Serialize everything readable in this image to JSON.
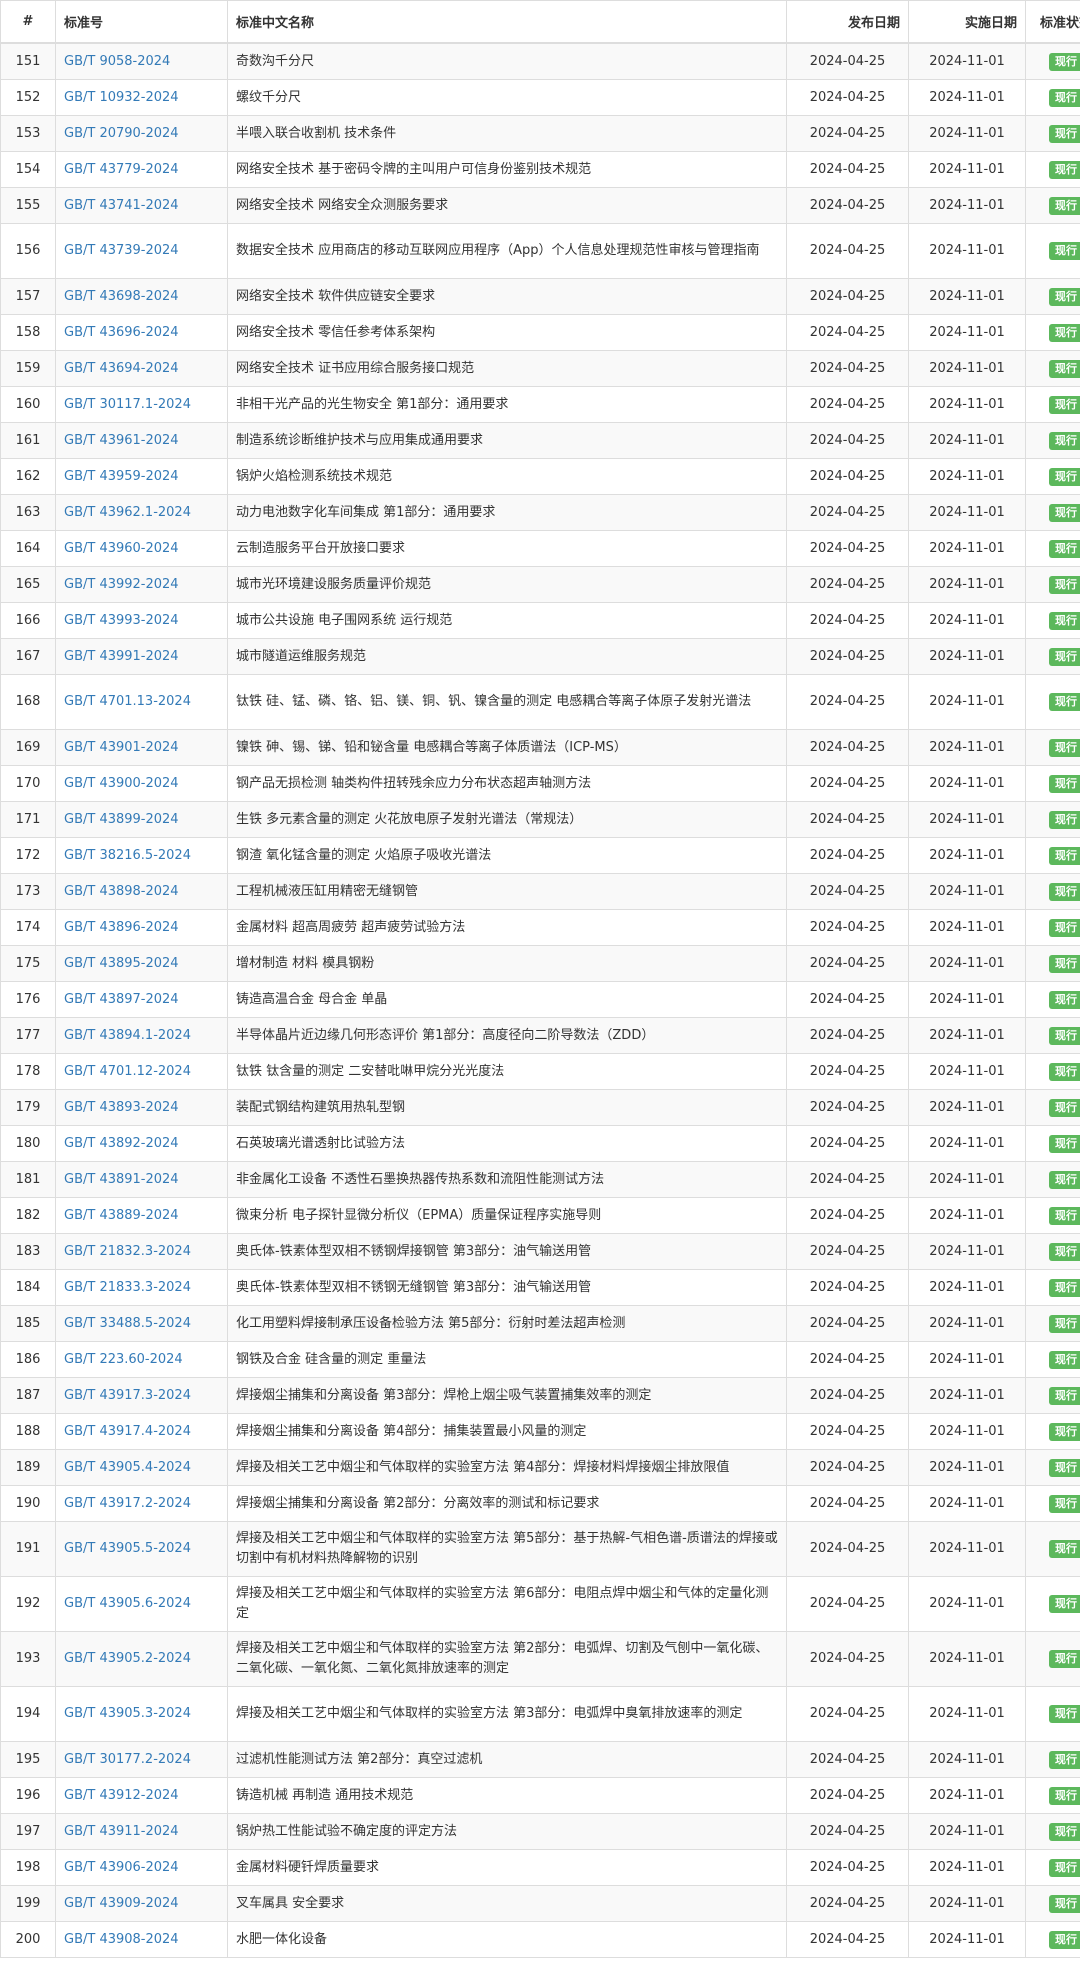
{
  "table": {
    "headers": {
      "num": "#",
      "code": "标准号",
      "name": "标准中文名称",
      "pub_date": "发布日期",
      "impl_date": "实施日期",
      "status": "标准状态"
    },
    "rows": [
      {
        "num": "151",
        "code": "GB/T 9058-2024",
        "name": "奇数沟千分尺",
        "pub": "2024-04-25",
        "impl": "2024-11-01",
        "status": "现行"
      },
      {
        "num": "152",
        "code": "GB/T 10932-2024",
        "name": "螺纹千分尺",
        "pub": "2024-04-25",
        "impl": "2024-11-01",
        "status": "现行"
      },
      {
        "num": "153",
        "code": "GB/T 20790-2024",
        "name": "半喂入联合收割机 技术条件",
        "pub": "2024-04-25",
        "impl": "2024-11-01",
        "status": "现行"
      },
      {
        "num": "154",
        "code": "GB/T 43779-2024",
        "name": "网络安全技术 基于密码令牌的主叫用户可信身份鉴别技术规范",
        "pub": "2024-04-25",
        "impl": "2024-11-01",
        "status": "现行"
      },
      {
        "num": "155",
        "code": "GB/T 43741-2024",
        "name": "网络安全技术 网络安全众测服务要求",
        "pub": "2024-04-25",
        "impl": "2024-11-01",
        "status": "现行"
      },
      {
        "num": "156",
        "code": "GB/T 43739-2024",
        "name": "数据安全技术 应用商店的移动互联网应用程序（App）个人信息处理规范性审核与管理指南",
        "pub": "2024-04-25",
        "impl": "2024-11-01",
        "status": "现行"
      },
      {
        "num": "157",
        "code": "GB/T 43698-2024",
        "name": "网络安全技术 软件供应链安全要求",
        "pub": "2024-04-25",
        "impl": "2024-11-01",
        "status": "现行"
      },
      {
        "num": "158",
        "code": "GB/T 43696-2024",
        "name": "网络安全技术 零信任参考体系架构",
        "pub": "2024-04-25",
        "impl": "2024-11-01",
        "status": "现行"
      },
      {
        "num": "159",
        "code": "GB/T 43694-2024",
        "name": "网络安全技术 证书应用综合服务接口规范",
        "pub": "2024-04-25",
        "impl": "2024-11-01",
        "status": "现行"
      },
      {
        "num": "160",
        "code": "GB/T 30117.1-2024",
        "name": "非相干光产品的光生物安全 第1部分：通用要求",
        "pub": "2024-04-25",
        "impl": "2024-11-01",
        "status": "现行"
      },
      {
        "num": "161",
        "code": "GB/T 43961-2024",
        "name": "制造系统诊断维护技术与应用集成通用要求",
        "pub": "2024-04-25",
        "impl": "2024-11-01",
        "status": "现行"
      },
      {
        "num": "162",
        "code": "GB/T 43959-2024",
        "name": "锅炉火焰检测系统技术规范",
        "pub": "2024-04-25",
        "impl": "2024-11-01",
        "status": "现行"
      },
      {
        "num": "163",
        "code": "GB/T 43962.1-2024",
        "name": "动力电池数字化车间集成 第1部分：通用要求",
        "pub": "2024-04-25",
        "impl": "2024-11-01",
        "status": "现行"
      },
      {
        "num": "164",
        "code": "GB/T 43960-2024",
        "name": "云制造服务平台开放接口要求",
        "pub": "2024-04-25",
        "impl": "2024-11-01",
        "status": "现行"
      },
      {
        "num": "165",
        "code": "GB/T 43992-2024",
        "name": "城市光环境建设服务质量评价规范",
        "pub": "2024-04-25",
        "impl": "2024-11-01",
        "status": "现行"
      },
      {
        "num": "166",
        "code": "GB/T 43993-2024",
        "name": "城市公共设施 电子围网系统 运行规范",
        "pub": "2024-04-25",
        "impl": "2024-11-01",
        "status": "现行"
      },
      {
        "num": "167",
        "code": "GB/T 43991-2024",
        "name": "城市隧道运维服务规范",
        "pub": "2024-04-25",
        "impl": "2024-11-01",
        "status": "现行"
      },
      {
        "num": "168",
        "code": "GB/T 4701.13-2024",
        "name": "钛铁 硅、锰、磷、铬、铝、镁、铜、钒、镍含量的测定 电感耦合等离子体原子发射光谱法",
        "pub": "2024-04-25",
        "impl": "2024-11-01",
        "status": "现行"
      },
      {
        "num": "169",
        "code": "GB/T 43901-2024",
        "name": "镍铁 砷、锡、锑、铅和铋含量 电感耦合等离子体质谱法（ICP-MS）",
        "pub": "2024-04-25",
        "impl": "2024-11-01",
        "status": "现行"
      },
      {
        "num": "170",
        "code": "GB/T 43900-2024",
        "name": "钢产品无损检测 轴类构件扭转残余应力分布状态超声轴测方法",
        "pub": "2024-04-25",
        "impl": "2024-11-01",
        "status": "现行"
      },
      {
        "num": "171",
        "code": "GB/T 43899-2024",
        "name": "生铁 多元素含量的测定 火花放电原子发射光谱法（常规法）",
        "pub": "2024-04-25",
        "impl": "2024-11-01",
        "status": "现行"
      },
      {
        "num": "172",
        "code": "GB/T 38216.5-2024",
        "name": "钢渣 氧化锰含量的测定 火焰原子吸收光谱法",
        "pub": "2024-04-25",
        "impl": "2024-11-01",
        "status": "现行"
      },
      {
        "num": "173",
        "code": "GB/T 43898-2024",
        "name": "工程机械液压缸用精密无缝钢管",
        "pub": "2024-04-25",
        "impl": "2024-11-01",
        "status": "现行"
      },
      {
        "num": "174",
        "code": "GB/T 43896-2024",
        "name": "金属材料 超高周疲劳 超声疲劳试验方法",
        "pub": "2024-04-25",
        "impl": "2024-11-01",
        "status": "现行"
      },
      {
        "num": "175",
        "code": "GB/T 43895-2024",
        "name": "增材制造 材料 模具钢粉",
        "pub": "2024-04-25",
        "impl": "2024-11-01",
        "status": "现行"
      },
      {
        "num": "176",
        "code": "GB/T 43897-2024",
        "name": "铸造高温合金 母合金 单晶",
        "pub": "2024-04-25",
        "impl": "2024-11-01",
        "status": "现行"
      },
      {
        "num": "177",
        "code": "GB/T 43894.1-2024",
        "name": "半导体晶片近边缘几何形态评价 第1部分：高度径向二阶导数法（ZDD）",
        "pub": "2024-04-25",
        "impl": "2024-11-01",
        "status": "现行"
      },
      {
        "num": "178",
        "code": "GB/T 4701.12-2024",
        "name": "钛铁 钛含量的测定 二安替吡啉甲烷分光光度法",
        "pub": "2024-04-25",
        "impl": "2024-11-01",
        "status": "现行"
      },
      {
        "num": "179",
        "code": "GB/T 43893-2024",
        "name": "装配式钢结构建筑用热轧型钢",
        "pub": "2024-04-25",
        "impl": "2024-11-01",
        "status": "现行"
      },
      {
        "num": "180",
        "code": "GB/T 43892-2024",
        "name": "石英玻璃光谱透射比试验方法",
        "pub": "2024-04-25",
        "impl": "2024-11-01",
        "status": "现行"
      },
      {
        "num": "181",
        "code": "GB/T 43891-2024",
        "name": "非金属化工设备 不透性石墨换热器传热系数和流阻性能测试方法",
        "pub": "2024-04-25",
        "impl": "2024-11-01",
        "status": "现行"
      },
      {
        "num": "182",
        "code": "GB/T 43889-2024",
        "name": "微束分析 电子探针显微分析仪（EPMA）质量保证程序实施导则",
        "pub": "2024-04-25",
        "impl": "2024-11-01",
        "status": "现行"
      },
      {
        "num": "183",
        "code": "GB/T 21832.3-2024",
        "name": "奥氏体-铁素体型双相不锈钢焊接钢管 第3部分：油气输送用管",
        "pub": "2024-04-25",
        "impl": "2024-11-01",
        "status": "现行"
      },
      {
        "num": "184",
        "code": "GB/T 21833.3-2024",
        "name": "奥氏体-铁素体型双相不锈钢无缝钢管 第3部分：油气输送用管",
        "pub": "2024-04-25",
        "impl": "2024-11-01",
        "status": "现行"
      },
      {
        "num": "185",
        "code": "GB/T 33488.5-2024",
        "name": "化工用塑料焊接制承压设备检验方法 第5部分：衍射时差法超声检测",
        "pub": "2024-04-25",
        "impl": "2024-11-01",
        "status": "现行"
      },
      {
        "num": "186",
        "code": "GB/T 223.60-2024",
        "name": "钢铁及合金 硅含量的测定 重量法",
        "pub": "2024-04-25",
        "impl": "2024-11-01",
        "status": "现行"
      },
      {
        "num": "187",
        "code": "GB/T 43917.3-2024",
        "name": "焊接烟尘捕集和分离设备 第3部分：焊枪上烟尘吸气装置捕集效率的测定",
        "pub": "2024-04-25",
        "impl": "2024-11-01",
        "status": "现行"
      },
      {
        "num": "188",
        "code": "GB/T 43917.4-2024",
        "name": "焊接烟尘捕集和分离设备 第4部分：捕集装置最小风量的测定",
        "pub": "2024-04-25",
        "impl": "2024-11-01",
        "status": "现行"
      },
      {
        "num": "189",
        "code": "GB/T 43905.4-2024",
        "name": "焊接及相关工艺中烟尘和气体取样的实验室方法 第4部分：焊接材料焊接烟尘排放限值",
        "pub": "2024-04-25",
        "impl": "2024-11-01",
        "status": "现行"
      },
      {
        "num": "190",
        "code": "GB/T 43917.2-2024",
        "name": "焊接烟尘捕集和分离设备 第2部分：分离效率的测试和标记要求",
        "pub": "2024-04-25",
        "impl": "2024-11-01",
        "status": "现行"
      },
      {
        "num": "191",
        "code": "GB/T 43905.5-2024",
        "name": "焊接及相关工艺中烟尘和气体取样的实验室方法 第5部分：基于热解-气相色谱-质谱法的焊接或切割中有机材料热降解物的识别",
        "pub": "2024-04-25",
        "impl": "2024-11-01",
        "status": "现行"
      },
      {
        "num": "192",
        "code": "GB/T 43905.6-2024",
        "name": "焊接及相关工艺中烟尘和气体取样的实验室方法 第6部分：电阻点焊中烟尘和气体的定量化测定",
        "pub": "2024-04-25",
        "impl": "2024-11-01",
        "status": "现行"
      },
      {
        "num": "193",
        "code": "GB/T 43905.2-2024",
        "name": "焊接及相关工艺中烟尘和气体取样的实验室方法 第2部分：电弧焊、切割及气刨中一氧化碳、二氧化碳、一氧化氮、二氧化氮排放速率的测定",
        "pub": "2024-04-25",
        "impl": "2024-11-01",
        "status": "现行"
      },
      {
        "num": "194",
        "code": "GB/T 43905.3-2024",
        "name": "焊接及相关工艺中烟尘和气体取样的实验室方法 第3部分：电弧焊中臭氧排放速率的测定",
        "pub": "2024-04-25",
        "impl": "2024-11-01",
        "status": "现行"
      },
      {
        "num": "195",
        "code": "GB/T 30177.2-2024",
        "name": "过滤机性能测试方法 第2部分：真空过滤机",
        "pub": "2024-04-25",
        "impl": "2024-11-01",
        "status": "现行"
      },
      {
        "num": "196",
        "code": "GB/T 43912-2024",
        "name": "铸造机械 再制造 通用技术规范",
        "pub": "2024-04-25",
        "impl": "2024-11-01",
        "status": "现行"
      },
      {
        "num": "197",
        "code": "GB/T 43911-2024",
        "name": "锅炉热工性能试验不确定度的评定方法",
        "pub": "2024-04-25",
        "impl": "2024-11-01",
        "status": "现行"
      },
      {
        "num": "198",
        "code": "GB/T 43906-2024",
        "name": "金属材料硬钎焊质量要求",
        "pub": "2024-04-25",
        "impl": "2024-11-01",
        "status": "现行"
      },
      {
        "num": "199",
        "code": "GB/T 43909-2024",
        "name": "叉车属具 安全要求",
        "pub": "2024-04-25",
        "impl": "2024-11-01",
        "status": "现行"
      },
      {
        "num": "200",
        "code": "GB/T 43908-2024",
        "name": "水肥一体化设备",
        "pub": "2024-04-25",
        "impl": "2024-11-01",
        "status": "现行"
      }
    ]
  }
}
